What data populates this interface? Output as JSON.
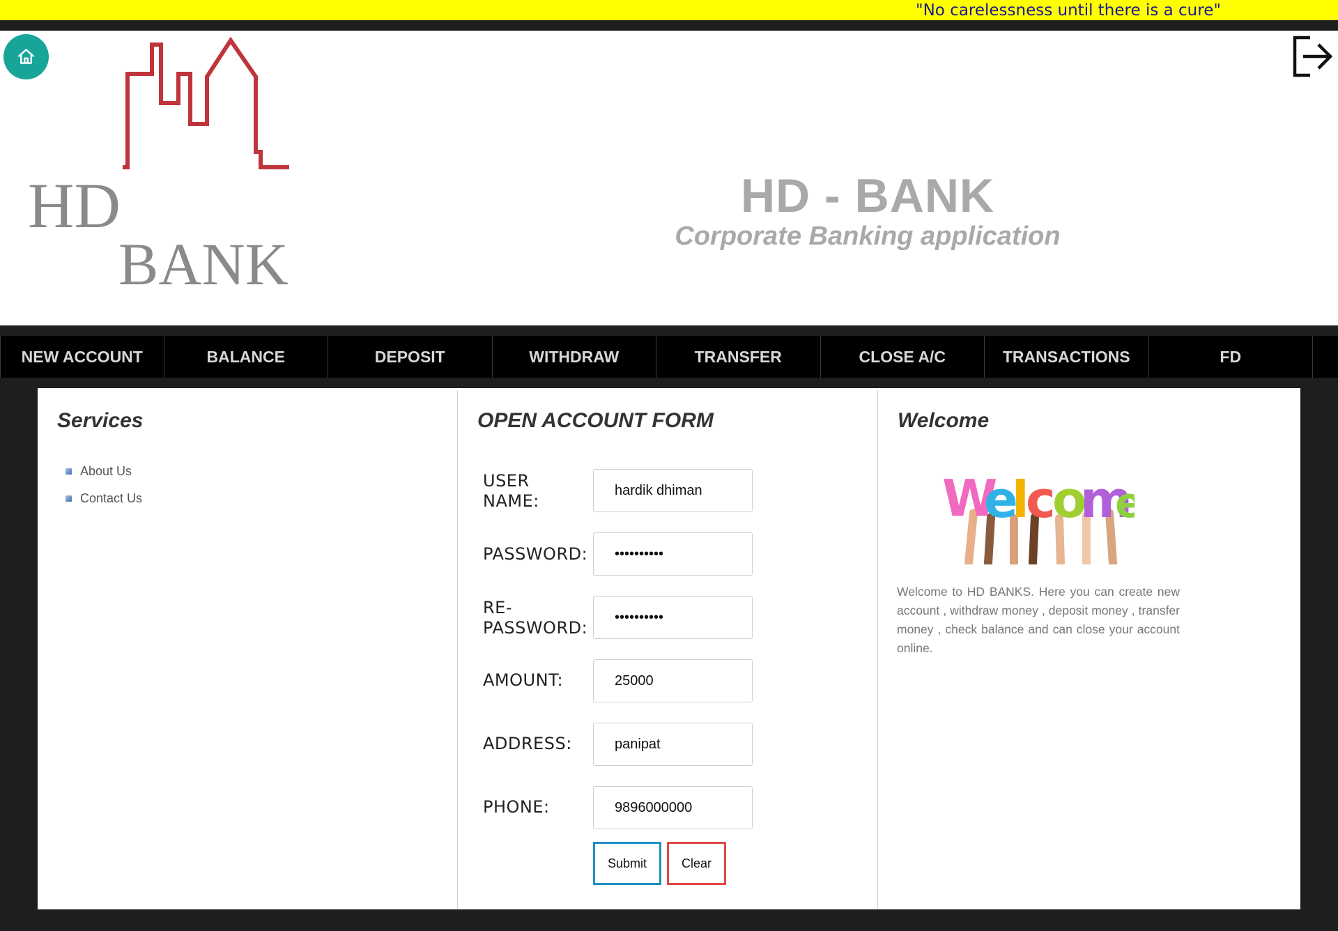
{
  "marquee": {
    "text": "\"No carelessness until there is a cure\"",
    "background": "#ffff00"
  },
  "header": {
    "title": "HD - BANK",
    "subtitle": "Corporate Banking application",
    "logo_text_line1": "HD",
    "logo_text_line2": "BANK",
    "home_icon": "home-icon",
    "logout_icon": "logout-icon",
    "accent": "#17a59a"
  },
  "nav": {
    "items": [
      {
        "label": "NEW ACCOUNT"
      },
      {
        "label": "BALANCE"
      },
      {
        "label": "DEPOSIT"
      },
      {
        "label": "WITHDRAW"
      },
      {
        "label": "TRANSFER"
      },
      {
        "label": "CLOSE A/C"
      },
      {
        "label": "TRANSACTIONS"
      },
      {
        "label": "FD"
      }
    ]
  },
  "services": {
    "title": "Services",
    "items": [
      {
        "label": "About Us"
      },
      {
        "label": "Contact Us"
      }
    ]
  },
  "form": {
    "title": "OPEN ACCOUNT FORM",
    "username_label_1": "USER",
    "username_label_2": "NAME:",
    "username_value": "hardik dhiman",
    "password_label": "PASSWORD:",
    "password_value": "••••••••••",
    "repassword_label_1": "RE-",
    "repassword_label_2": "PASSWORD:",
    "repassword_value": "••••••••••",
    "amount_label": "AMOUNT:",
    "amount_value": "25000",
    "address_label": "ADDRESS:",
    "address_value": "panipat",
    "phone_label": "PHONE:",
    "phone_value": "9896000000",
    "submit_label": "Submit",
    "clear_label": "Clear"
  },
  "welcome": {
    "title": "Welcome",
    "image_text": "Welcome",
    "body": "Welcome to HD BANKS. Here you can create new account , withdraw money , deposit money , transfer money , check balance and can close your account online."
  }
}
